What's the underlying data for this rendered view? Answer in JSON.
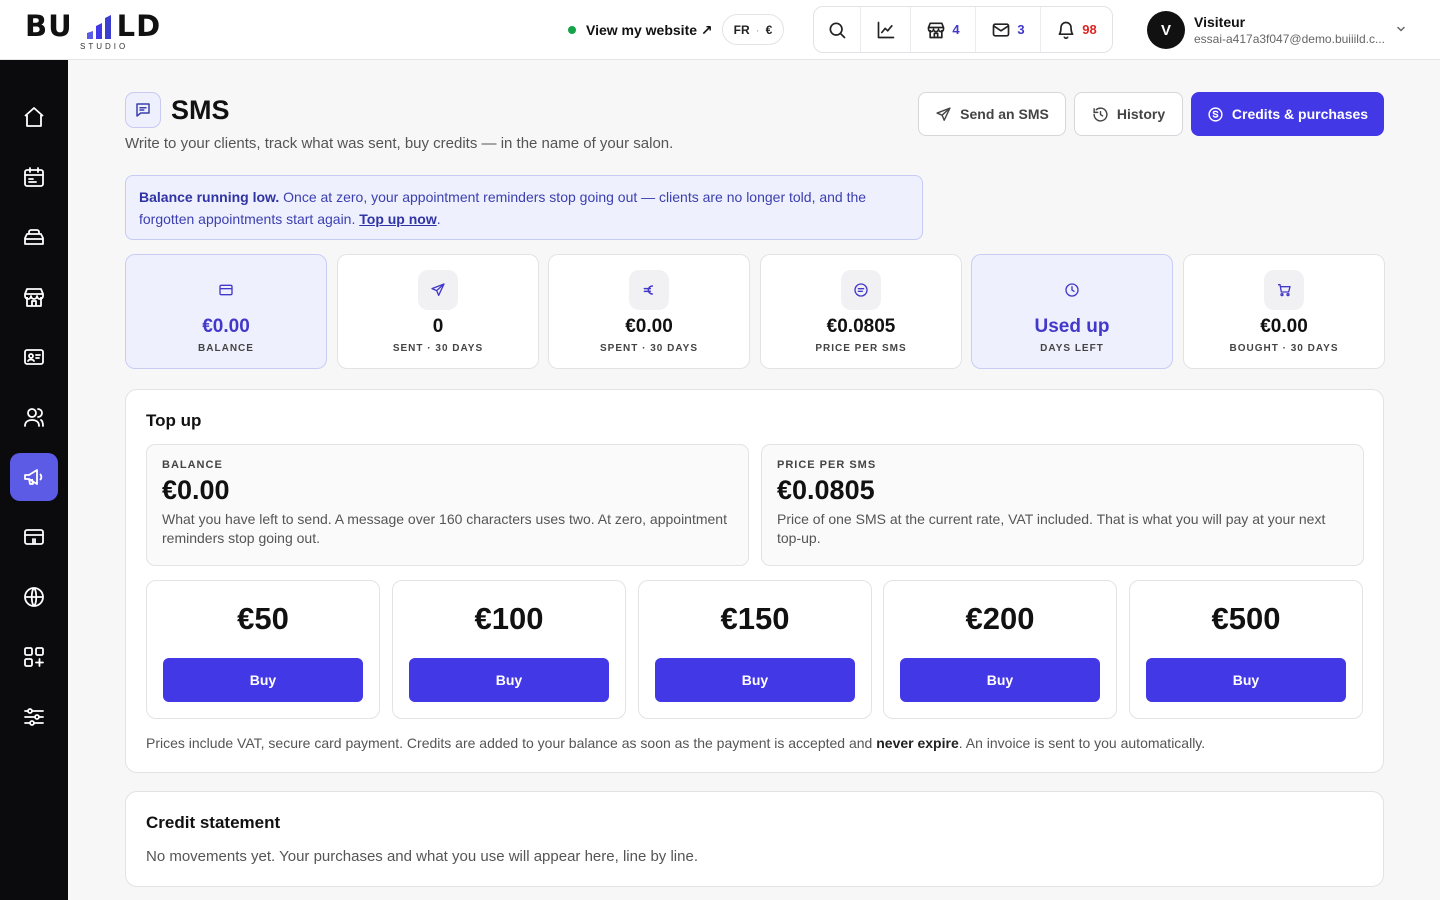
{
  "brand": {
    "logo_text": "BUILD",
    "logo_sub": "STUDIO"
  },
  "topbar": {
    "view_site": "View my website ↗",
    "lang": "FR",
    "currency": "€",
    "counts": {
      "bookings": "4",
      "messages": "3",
      "notifications": "98"
    },
    "user": {
      "initial": "V",
      "name": "Visiteur",
      "email": "essai-a417a3f047@demo.buiiild.c..."
    }
  },
  "page": {
    "title": "SMS",
    "subtitle": "Write to your clients, track what was sent, buy credits — in the name of your salon.",
    "buttons": {
      "send": "Send an SMS",
      "history": "History",
      "credits": "Credits & purchases"
    }
  },
  "alert": {
    "strong": "Balance running low.",
    "text": " Once at zero, your appointment reminders stop going out — clients are no longer told, and the forgotten appointments start again. ",
    "link": "Top up now",
    "end": "."
  },
  "stats": [
    {
      "value": "€0.00",
      "label": "BALANCE",
      "icon": "card-icon"
    },
    {
      "value": "0",
      "label": "SENT · 30 DAYS",
      "icon": "send-icon"
    },
    {
      "value": "€0.00",
      "label": "SPENT · 30 DAYS",
      "icon": "euro-icon"
    },
    {
      "value": "€0.0805",
      "label": "PRICE PER SMS",
      "icon": "message-icon"
    },
    {
      "value": "Used up",
      "label": "DAYS LEFT",
      "icon": "clock-icon"
    },
    {
      "value": "€0.00",
      "label": "BOUGHT · 30 DAYS",
      "icon": "cart-icon"
    }
  ],
  "topup": {
    "title": "Top up",
    "balance": {
      "label": "BALANCE",
      "value": "€0.00",
      "desc": "What you have left to send. A message over 160 characters uses two. At zero, appointment reminders stop going out."
    },
    "price": {
      "label": "PRICE PER SMS",
      "value": "€0.0805",
      "desc": "Price of one SMS at the current rate, VAT included. That is what you will pay at your next top-up."
    },
    "packs": [
      {
        "amount": "€50",
        "buy": "Buy"
      },
      {
        "amount": "€100",
        "buy": "Buy"
      },
      {
        "amount": "€150",
        "buy": "Buy"
      },
      {
        "amount": "€200",
        "buy": "Buy"
      },
      {
        "amount": "€500",
        "buy": "Buy"
      }
    ],
    "note_start": "Prices include VAT, secure card payment. Credits are added to your balance as soon as the payment is accepted and ",
    "note_strong": "never expire",
    "note_end": ". An invoice is sent to you automatically."
  },
  "statement": {
    "title": "Credit statement",
    "empty": "No movements yet. Your purchases and what you use will appear here, line by line."
  },
  "colors": {
    "accent": "#4338e6",
    "sidebar": "#0b0b0d",
    "active_item": "#5b5be6"
  }
}
